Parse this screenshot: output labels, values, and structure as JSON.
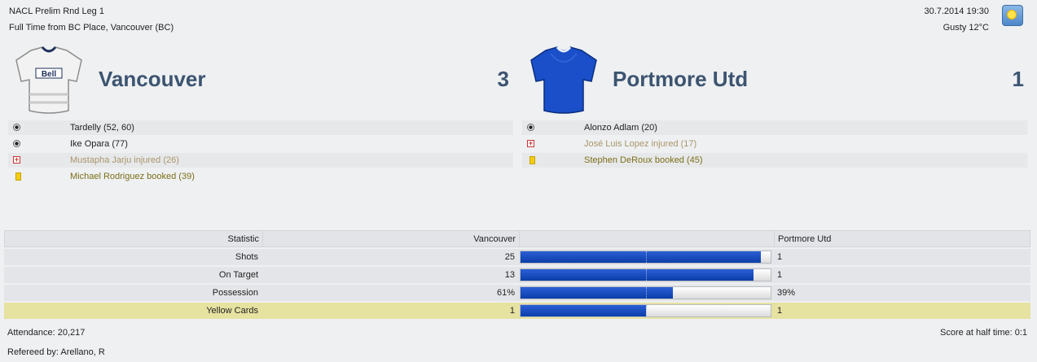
{
  "match": {
    "competition": "NACL Prelim Rnd Leg 1",
    "venue_line": "Full Time from BC Place, Vancouver (BC)",
    "datetime": "30.7.2014 19:30",
    "weather": "Gusty 12°C",
    "weather_icon": "sun-icon"
  },
  "home": {
    "name": "Vancouver",
    "score": "3",
    "shirt_icon": "white-shirt-icon",
    "events": [
      {
        "type": "goal",
        "icon": "ball-icon",
        "text": "Tardelly (52, 60)"
      },
      {
        "type": "goal",
        "icon": "ball-icon",
        "text": "Ike Opara (77)"
      },
      {
        "type": "injury",
        "icon": "injury-icon",
        "text": "Mustapha Jarju injured (26)"
      },
      {
        "type": "booked",
        "icon": "yellow-card-icon",
        "text": "Michael Rodriguez booked (39)"
      }
    ]
  },
  "away": {
    "name": "Portmore Utd",
    "score": "1",
    "shirt_icon": "blue-shirt-icon",
    "events": [
      {
        "type": "goal",
        "icon": "ball-icon",
        "text": "Alonzo Adlam (20)"
      },
      {
        "type": "injury",
        "icon": "injury-icon",
        "text": "José Luis Lopez injured (17)"
      },
      {
        "type": "booked",
        "icon": "yellow-card-icon",
        "text": "Stephen DeRoux booked (45)"
      }
    ]
  },
  "stats": {
    "header": {
      "statistic": "Statistic",
      "home": "Vancouver",
      "away": "Portmore Utd"
    },
    "rows": [
      {
        "label": "Shots",
        "home": "25",
        "away": "1",
        "home_share": 0.96
      },
      {
        "label": "On Target",
        "home": "13",
        "away": "1",
        "home_share": 0.93
      },
      {
        "label": "Possession",
        "home": "61%",
        "away": "39%",
        "home_share": 0.61
      },
      {
        "label": "Yellow Cards",
        "home": "1",
        "away": "1",
        "home_share": 0.5
      }
    ]
  },
  "footer": {
    "attendance": "Attendance: 20,217",
    "halftime": "Score at half time: 0:1",
    "referee": "Refereed by: Arellano, R"
  },
  "colors": {
    "team_text": "#3c5470",
    "bar_fill": "#0b3ea8",
    "highlight_row": "#e6e2a0"
  }
}
